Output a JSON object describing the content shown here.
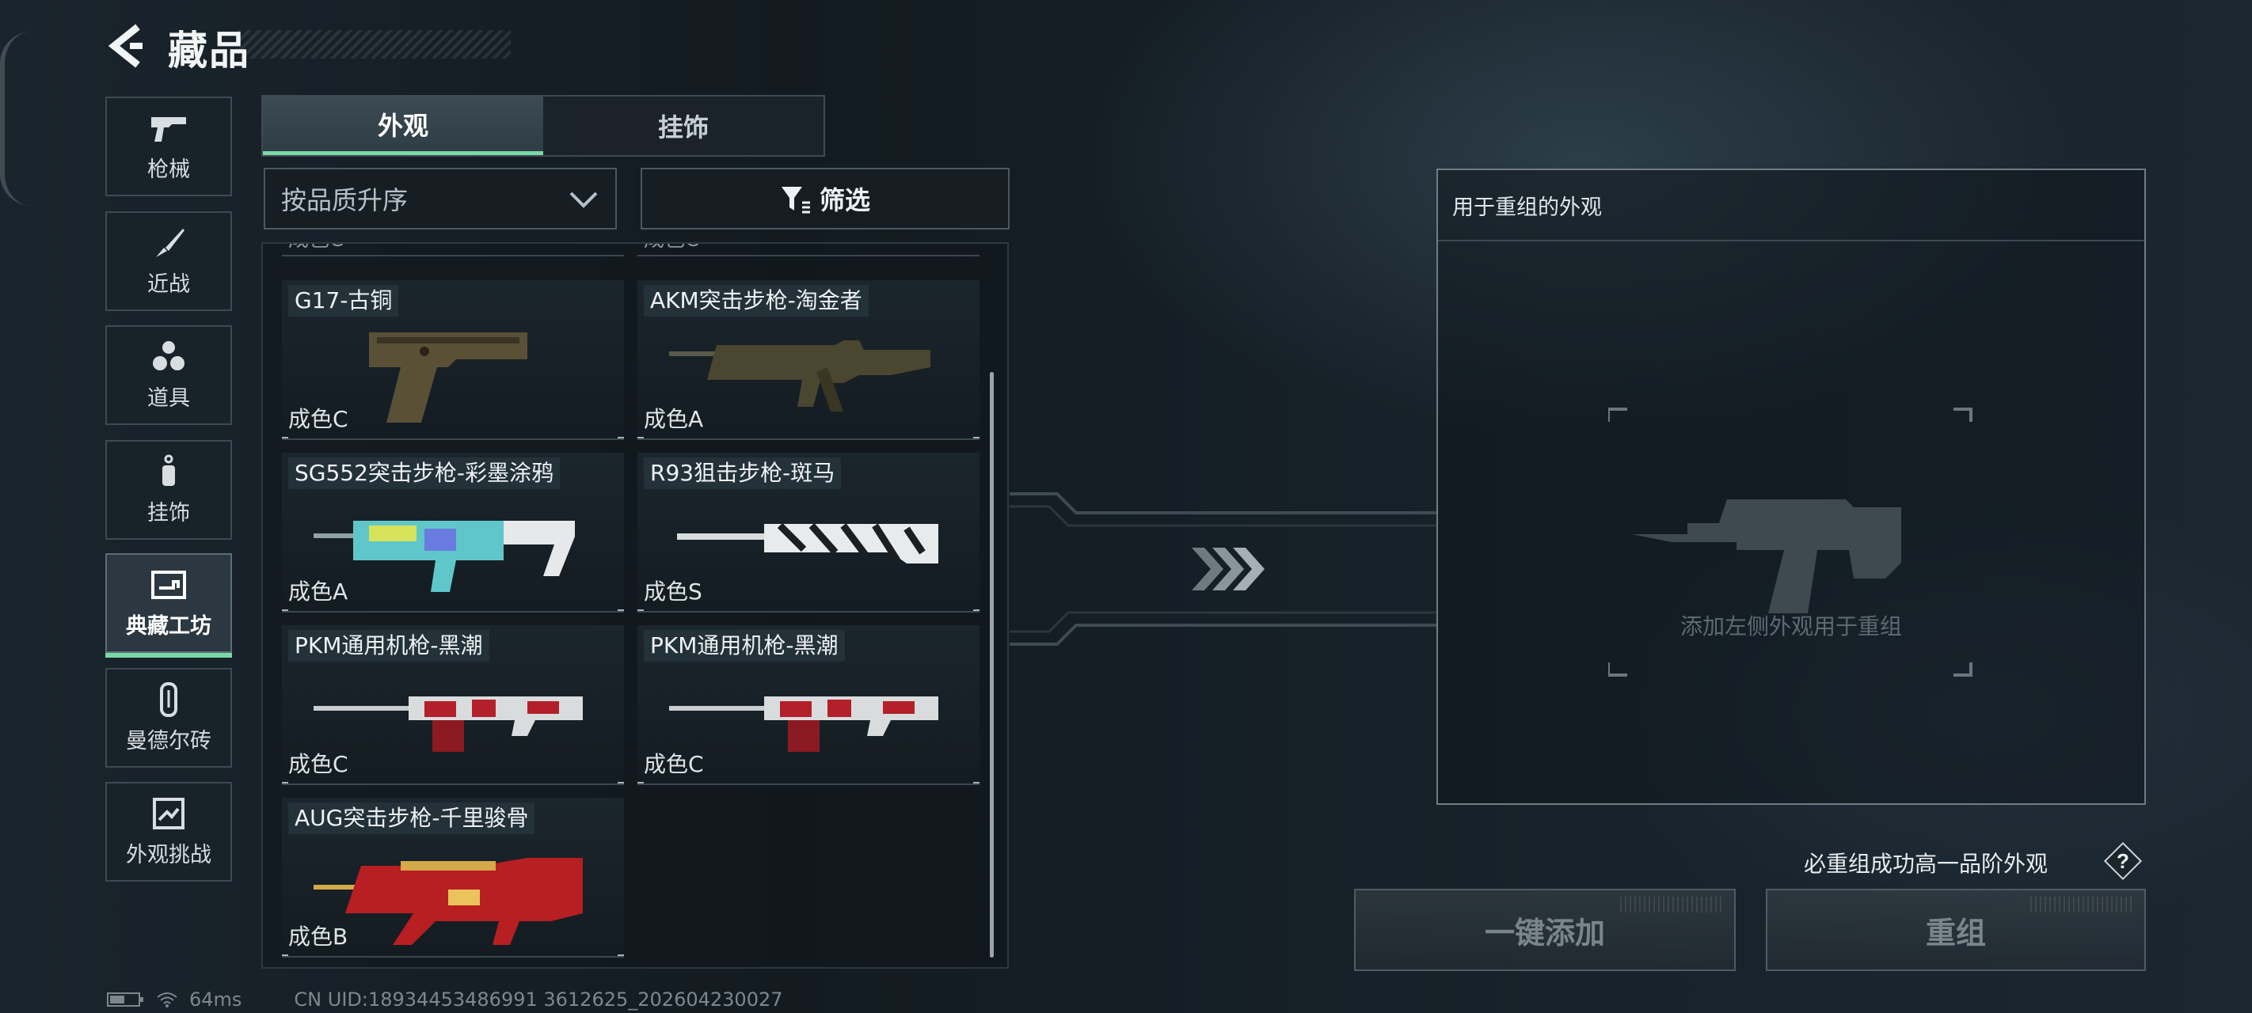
{
  "header": {
    "title": "藏品"
  },
  "sidebar": {
    "items": [
      {
        "label": "枪械",
        "icon": "pistol-icon"
      },
      {
        "label": "近战",
        "icon": "knife-icon"
      },
      {
        "label": "道具",
        "icon": "grenades-icon"
      },
      {
        "label": "挂饰",
        "icon": "charm-icon"
      },
      {
        "label": "典藏工坊",
        "icon": "workshop-icon",
        "active": true
      },
      {
        "label": "曼德尔砖",
        "icon": "mandel-brick-icon"
      },
      {
        "label": "外观挑战",
        "icon": "skin-challenge-icon"
      }
    ]
  },
  "tabs": [
    {
      "label": "外观",
      "active": true
    },
    {
      "label": "挂饰",
      "active": false
    }
  ],
  "sort": {
    "value": "按品质升序"
  },
  "filter": {
    "label": "筛选"
  },
  "grid": {
    "partial_top": [
      "成色C",
      "成色C"
    ],
    "items": [
      {
        "name": "G17-古铜",
        "grade": "成色C",
        "icon": "pistol-skin-icon"
      },
      {
        "name": "AKM突击步枪-淘金者",
        "grade": "成色A",
        "icon": "rifle-skin-icon"
      },
      {
        "name": "SG552突击步枪-彩墨涂鸦",
        "grade": "成色A",
        "icon": "rifle-skin-icon"
      },
      {
        "name": "R93狙击步枪-斑马",
        "grade": "成色S",
        "icon": "sniper-skin-icon"
      },
      {
        "name": "PKM通用机枪-黑潮",
        "grade": "成色C",
        "icon": "machinegun-skin-icon"
      },
      {
        "name": "PKM通用机枪-黑潮",
        "grade": "成色C",
        "icon": "machinegun-skin-icon"
      },
      {
        "name": "AUG突击步枪-千里骏骨",
        "grade": "成色B",
        "icon": "bullpup-skin-icon"
      }
    ]
  },
  "recombine": {
    "header": "用于重组的外观",
    "hint": "添加左侧外观用于重组",
    "guarantee_note": "必重组成功高一品阶外观",
    "help": "?",
    "one_click_add": "一键添加",
    "recombine_button": "重组"
  },
  "status": {
    "ping": "64ms",
    "uid": "CN UID:18934453486991 3612625_202604230027"
  },
  "colors": {
    "accent": "#79d9a8"
  }
}
